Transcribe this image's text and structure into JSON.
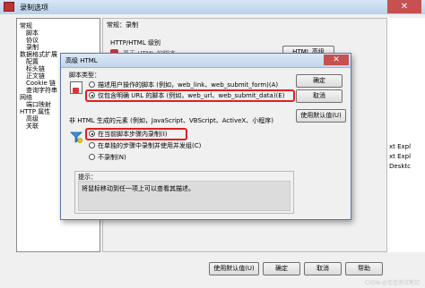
{
  "window": {
    "title": "录制选项",
    "close_glyph": "✕"
  },
  "tree": {
    "items": [
      {
        "label": "常规",
        "indent": 0
      },
      {
        "label": "脚本",
        "indent": 1
      },
      {
        "label": "协议",
        "indent": 1
      },
      {
        "label": "录制",
        "indent": 1
      },
      {
        "label": "数据格式扩展",
        "indent": 0
      },
      {
        "label": "配置",
        "indent": 1
      },
      {
        "label": "标头链",
        "indent": 1
      },
      {
        "label": "正文链",
        "indent": 1
      },
      {
        "label": "Cookie 链",
        "indent": 1
      },
      {
        "label": "查询字符串",
        "indent": 1
      },
      {
        "label": "网络",
        "indent": 0
      },
      {
        "label": "端口映射",
        "indent": 1
      },
      {
        "label": "HTTP 属性",
        "indent": 0
      },
      {
        "label": "高级",
        "indent": 1
      },
      {
        "label": "关联",
        "indent": 1
      }
    ]
  },
  "right_pane": {
    "header": "常规：录制",
    "group_label": "HTTP/HTML 级别",
    "partial_option": "基于 HTML 的脚本",
    "partial_button": "HTML 高级"
  },
  "ext_strip": {
    "rows": [
      "",
      "",
      "",
      "",
      "",
      "xt Expl",
      "xt Expl",
      "Desktc",
      "",
      ""
    ]
  },
  "bottom_buttons": {
    "use_default": "使用默认值(U)",
    "ok": "确定",
    "cancel": "取消",
    "help": "帮助"
  },
  "modal": {
    "title": "高级 HTML",
    "close_glyph": "✕",
    "script_type_label": "脚本类型：",
    "options_script_type": [
      {
        "label": "描述用户操作的脚本 (例如，web_link、web_submit_form)(A)",
        "checked": false
      },
      {
        "label": "仅包含明确 URL 的脚本 (例如，web_url、web_submit_data)(E)",
        "checked": true
      }
    ],
    "non_html_label": "非 HTML 生成的元素 (例如，JavaScript、VBScript、ActiveX、小程序)",
    "options_non_html": [
      {
        "label": "在当前脚本步骤内录制(I)",
        "checked": true
      },
      {
        "label": "在单独的步骤中录制并使用并发组(C)",
        "checked": false
      },
      {
        "label": "不录制(N)",
        "checked": false
      }
    ],
    "buttons": {
      "ok": "确定",
      "cancel": "取消",
      "use_default": "使用默认值(U)"
    },
    "hint_label": "提示：",
    "hint_text": "将鼠标移动到任一项上可以查看其描述。"
  },
  "watermark": "CSDN @佳佳测试笔记",
  "colors": {
    "highlight_box": "#e02020",
    "title_bar": "#c2d6ec",
    "close_button": "#c75050"
  }
}
